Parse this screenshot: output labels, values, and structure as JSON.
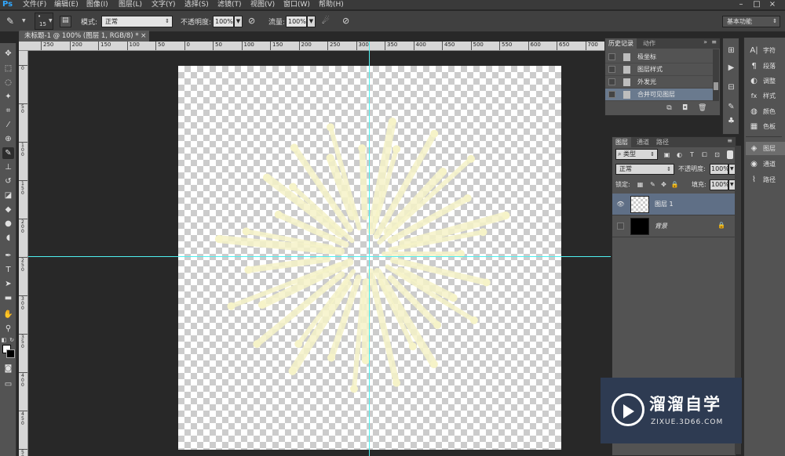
{
  "app": {
    "logo": "Ps"
  },
  "menus": [
    "文件(F)",
    "编辑(E)",
    "图像(I)",
    "图层(L)",
    "文字(Y)",
    "选择(S)",
    "滤镜(T)",
    "视图(V)",
    "窗口(W)",
    "帮助(H)"
  ],
  "options_bar": {
    "brush_size": "15",
    "mode_label": "模式:",
    "mode_value": "正常",
    "opacity_label": "不透明度:",
    "opacity_value": "100%",
    "flow_label": "流量:",
    "flow_value": "100%",
    "workspace": "基本功能"
  },
  "document": {
    "tab_title": "未标题-1 @ 100% (图层 1, RGB/8) *",
    "close": "×"
  },
  "rulers": {
    "horizontal": [
      "250",
      "200",
      "150",
      "100",
      "50",
      "0",
      "50",
      "100",
      "150",
      "200",
      "250",
      "300",
      "350",
      "400",
      "450",
      "500",
      "550",
      "600",
      "650",
      "700"
    ],
    "vertical": [
      "0",
      "5\n0",
      "1\n0\n0",
      "1\n5\n0",
      "2\n0\n0",
      "2\n5\n0",
      "3\n0\n0",
      "3\n5\n0",
      "4\n0\n0",
      "4\n5\n0",
      "5\n0\n0"
    ]
  },
  "history_panel": {
    "tabs": [
      "历史记录",
      "动作"
    ],
    "items": [
      "极坐标",
      "图层样式",
      "外发光",
      "合并可见图层"
    ],
    "selected_index": 3
  },
  "right_column": {
    "items": [
      {
        "icon": "A|",
        "label": "字符"
      },
      {
        "icon": "¶",
        "label": "段落"
      },
      {
        "icon": "◐",
        "label": "调整"
      },
      {
        "icon": "fx",
        "label": "样式"
      },
      {
        "icon": "◍",
        "label": "颜色"
      },
      {
        "icon": "▦",
        "label": "色板"
      },
      {
        "icon": "◈",
        "label": "图层"
      },
      {
        "icon": "◉",
        "label": "通道"
      },
      {
        "icon": "⌇",
        "label": "路径"
      }
    ]
  },
  "layers_panel": {
    "tabs": [
      "图层",
      "通道",
      "路径"
    ],
    "filter_kind": "类型",
    "blend_mode": "正常",
    "opacity_label": "不透明度:",
    "opacity_value": "100%",
    "lock_label": "锁定:",
    "fill_label": "填充:",
    "fill_value": "100%",
    "layers": [
      {
        "name": "图层 1",
        "visible": true,
        "selected": true
      },
      {
        "name": "背景",
        "visible": false,
        "selected": false,
        "locked": true
      }
    ]
  },
  "watermark": {
    "title": "溜溜自学",
    "url": "ZIXUE.3D66.COM"
  },
  "colors": {
    "accent_ps": "#31a8ff",
    "guide": "#4ff0f0",
    "firework": "#f6f3c8",
    "selection": "#5f6f86"
  }
}
